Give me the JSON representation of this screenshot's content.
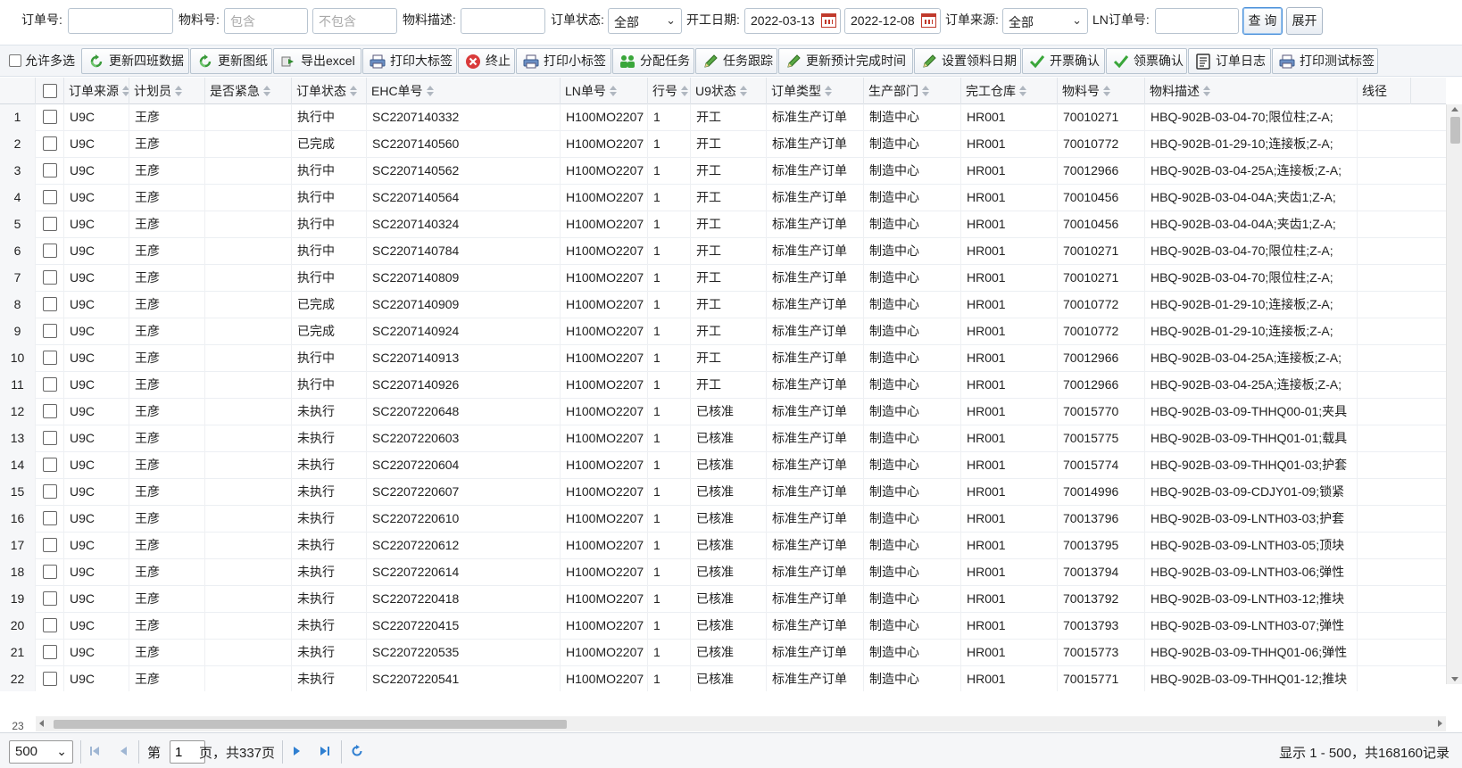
{
  "filters": {
    "order_no_label": "订单号:",
    "order_no_value": "",
    "material_no_label": "物料号:",
    "material_include_placeholder": "包含",
    "material_exclude_placeholder": "不包含",
    "material_desc_label": "物料描述:",
    "material_desc_value": "",
    "status_label": "订单状态:",
    "status_value": "全部",
    "start_date_label": "开工日期:",
    "start_date_from": "2022-03-13",
    "start_date_to": "2022-12-08",
    "source_label": "订单来源:",
    "source_value": "全部",
    "ln_order_label": "LN订单号:",
    "ln_order_value": "",
    "query_button": "查 询",
    "expand_button": "展开"
  },
  "toolbar": {
    "allow_multi_select": "允许多选",
    "buttons": [
      {
        "label": "更新四班数据",
        "icon": "refresh-icon"
      },
      {
        "label": "更新图纸",
        "icon": "refresh-icon"
      },
      {
        "label": "导出excel",
        "icon": "export-icon"
      },
      {
        "label": "打印大标签",
        "icon": "printer-icon"
      },
      {
        "label": "终止",
        "icon": "stop-icon"
      },
      {
        "label": "打印小标签",
        "icon": "printer-icon"
      },
      {
        "label": "分配任务",
        "icon": "assign-icon"
      },
      {
        "label": "任务跟踪",
        "icon": "pencil-icon"
      },
      {
        "label": "更新预计完成时间",
        "icon": "pencil-icon"
      },
      {
        "label": "设置领料日期",
        "icon": "pencil-icon"
      },
      {
        "label": "开票确认",
        "icon": "check-icon"
      },
      {
        "label": "领票确认",
        "icon": "check-icon"
      },
      {
        "label": "订单日志",
        "icon": "log-icon"
      },
      {
        "label": "打印测试标签",
        "icon": "printer-icon"
      }
    ]
  },
  "grid": {
    "columns": [
      "订单来源",
      "计划员",
      "是否紧急",
      "订单状态",
      "EHC单号",
      "LN单号",
      "行号",
      "U9状态",
      "订单类型",
      "生产部门",
      "完工仓库",
      "物料号",
      "物料描述",
      "线径"
    ],
    "rows": [
      [
        "1",
        "U9C",
        "王彦",
        "",
        "执行中",
        "SC2207140332",
        "H100MO2207",
        "1",
        "开工",
        "标准生产订单",
        "制造中心",
        "HR001",
        "70010271",
        "HBQ-902B-03-04-70;限位柱;Z-A;"
      ],
      [
        "2",
        "U9C",
        "王彦",
        "",
        "已完成",
        "SC2207140560",
        "H100MO2207",
        "1",
        "开工",
        "标准生产订单",
        "制造中心",
        "HR001",
        "70010772",
        "HBQ-902B-01-29-10;连接板;Z-A;"
      ],
      [
        "3",
        "U9C",
        "王彦",
        "",
        "执行中",
        "SC2207140562",
        "H100MO2207",
        "1",
        "开工",
        "标准生产订单",
        "制造中心",
        "HR001",
        "70012966",
        "HBQ-902B-03-04-25A;连接板;Z-A;"
      ],
      [
        "4",
        "U9C",
        "王彦",
        "",
        "执行中",
        "SC2207140564",
        "H100MO2207",
        "1",
        "开工",
        "标准生产订单",
        "制造中心",
        "HR001",
        "70010456",
        "HBQ-902B-03-04-04A;夹齿1;Z-A;"
      ],
      [
        "5",
        "U9C",
        "王彦",
        "",
        "执行中",
        "SC2207140324",
        "H100MO2207",
        "1",
        "开工",
        "标准生产订单",
        "制造中心",
        "HR001",
        "70010456",
        "HBQ-902B-03-04-04A;夹齿1;Z-A;"
      ],
      [
        "6",
        "U9C",
        "王彦",
        "",
        "执行中",
        "SC2207140784",
        "H100MO2207",
        "1",
        "开工",
        "标准生产订单",
        "制造中心",
        "HR001",
        "70010271",
        "HBQ-902B-03-04-70;限位柱;Z-A;"
      ],
      [
        "7",
        "U9C",
        "王彦",
        "",
        "执行中",
        "SC2207140809",
        "H100MO2207",
        "1",
        "开工",
        "标准生产订单",
        "制造中心",
        "HR001",
        "70010271",
        "HBQ-902B-03-04-70;限位柱;Z-A;"
      ],
      [
        "8",
        "U9C",
        "王彦",
        "",
        "已完成",
        "SC2207140909",
        "H100MO2207",
        "1",
        "开工",
        "标准生产订单",
        "制造中心",
        "HR001",
        "70010772",
        "HBQ-902B-01-29-10;连接板;Z-A;"
      ],
      [
        "9",
        "U9C",
        "王彦",
        "",
        "已完成",
        "SC2207140924",
        "H100MO2207",
        "1",
        "开工",
        "标准生产订单",
        "制造中心",
        "HR001",
        "70010772",
        "HBQ-902B-01-29-10;连接板;Z-A;"
      ],
      [
        "10",
        "U9C",
        "王彦",
        "",
        "执行中",
        "SC2207140913",
        "H100MO2207",
        "1",
        "开工",
        "标准生产订单",
        "制造中心",
        "HR001",
        "70012966",
        "HBQ-902B-03-04-25A;连接板;Z-A;"
      ],
      [
        "11",
        "U9C",
        "王彦",
        "",
        "执行中",
        "SC2207140926",
        "H100MO2207",
        "1",
        "开工",
        "标准生产订单",
        "制造中心",
        "HR001",
        "70012966",
        "HBQ-902B-03-04-25A;连接板;Z-A;"
      ],
      [
        "12",
        "U9C",
        "王彦",
        "",
        "未执行",
        "SC2207220648",
        "H100MO2207",
        "1",
        "已核准",
        "标准生产订单",
        "制造中心",
        "HR001",
        "70015770",
        "HBQ-902B-03-09-THHQ00-01;夹具"
      ],
      [
        "13",
        "U9C",
        "王彦",
        "",
        "未执行",
        "SC2207220603",
        "H100MO2207",
        "1",
        "已核准",
        "标准生产订单",
        "制造中心",
        "HR001",
        "70015775",
        "HBQ-902B-03-09-THHQ01-01;载具"
      ],
      [
        "14",
        "U9C",
        "王彦",
        "",
        "未执行",
        "SC2207220604",
        "H100MO2207",
        "1",
        "已核准",
        "标准生产订单",
        "制造中心",
        "HR001",
        "70015774",
        "HBQ-902B-03-09-THHQ01-03;护套"
      ],
      [
        "15",
        "U9C",
        "王彦",
        "",
        "未执行",
        "SC2207220607",
        "H100MO2207",
        "1",
        "已核准",
        "标准生产订单",
        "制造中心",
        "HR001",
        "70014996",
        "HBQ-902B-03-09-CDJY01-09;锁紧"
      ],
      [
        "16",
        "U9C",
        "王彦",
        "",
        "未执行",
        "SC2207220610",
        "H100MO2207",
        "1",
        "已核准",
        "标准生产订单",
        "制造中心",
        "HR001",
        "70013796",
        "HBQ-902B-03-09-LNTH03-03;护套"
      ],
      [
        "17",
        "U9C",
        "王彦",
        "",
        "未执行",
        "SC2207220612",
        "H100MO2207",
        "1",
        "已核准",
        "标准生产订单",
        "制造中心",
        "HR001",
        "70013795",
        "HBQ-902B-03-09-LNTH03-05;顶块"
      ],
      [
        "18",
        "U9C",
        "王彦",
        "",
        "未执行",
        "SC2207220614",
        "H100MO2207",
        "1",
        "已核准",
        "标准生产订单",
        "制造中心",
        "HR001",
        "70013794",
        "HBQ-902B-03-09-LNTH03-06;弹性"
      ],
      [
        "19",
        "U9C",
        "王彦",
        "",
        "未执行",
        "SC2207220418",
        "H100MO2207",
        "1",
        "已核准",
        "标准生产订单",
        "制造中心",
        "HR001",
        "70013792",
        "HBQ-902B-03-09-LNTH03-12;推块"
      ],
      [
        "20",
        "U9C",
        "王彦",
        "",
        "未执行",
        "SC2207220415",
        "H100MO2207",
        "1",
        "已核准",
        "标准生产订单",
        "制造中心",
        "HR001",
        "70013793",
        "HBQ-902B-03-09-LNTH03-07;弹性"
      ],
      [
        "21",
        "U9C",
        "王彦",
        "",
        "未执行",
        "SC2207220535",
        "H100MO2207",
        "1",
        "已核准",
        "标准生产订单",
        "制造中心",
        "HR001",
        "70015773",
        "HBQ-902B-03-09-THHQ01-06;弹性"
      ],
      [
        "22",
        "U9C",
        "王彦",
        "",
        "未执行",
        "SC2207220541",
        "H100MO2207",
        "1",
        "已核准",
        "标准生产订单",
        "制造中心",
        "HR001",
        "70015771",
        "HBQ-902B-03-09-THHQ01-12;推块"
      ]
    ],
    "partial_row_num": "23"
  },
  "pager": {
    "page_size": "500",
    "page_prefix": "第",
    "page_value": "1",
    "page_suffix": "页，共337页",
    "info": "显示 1 - 500，共168160记录"
  },
  "colors": {
    "accent": "#2f7fd1",
    "header_bg": "#f6f7f9",
    "border": "#d4d9e0"
  }
}
